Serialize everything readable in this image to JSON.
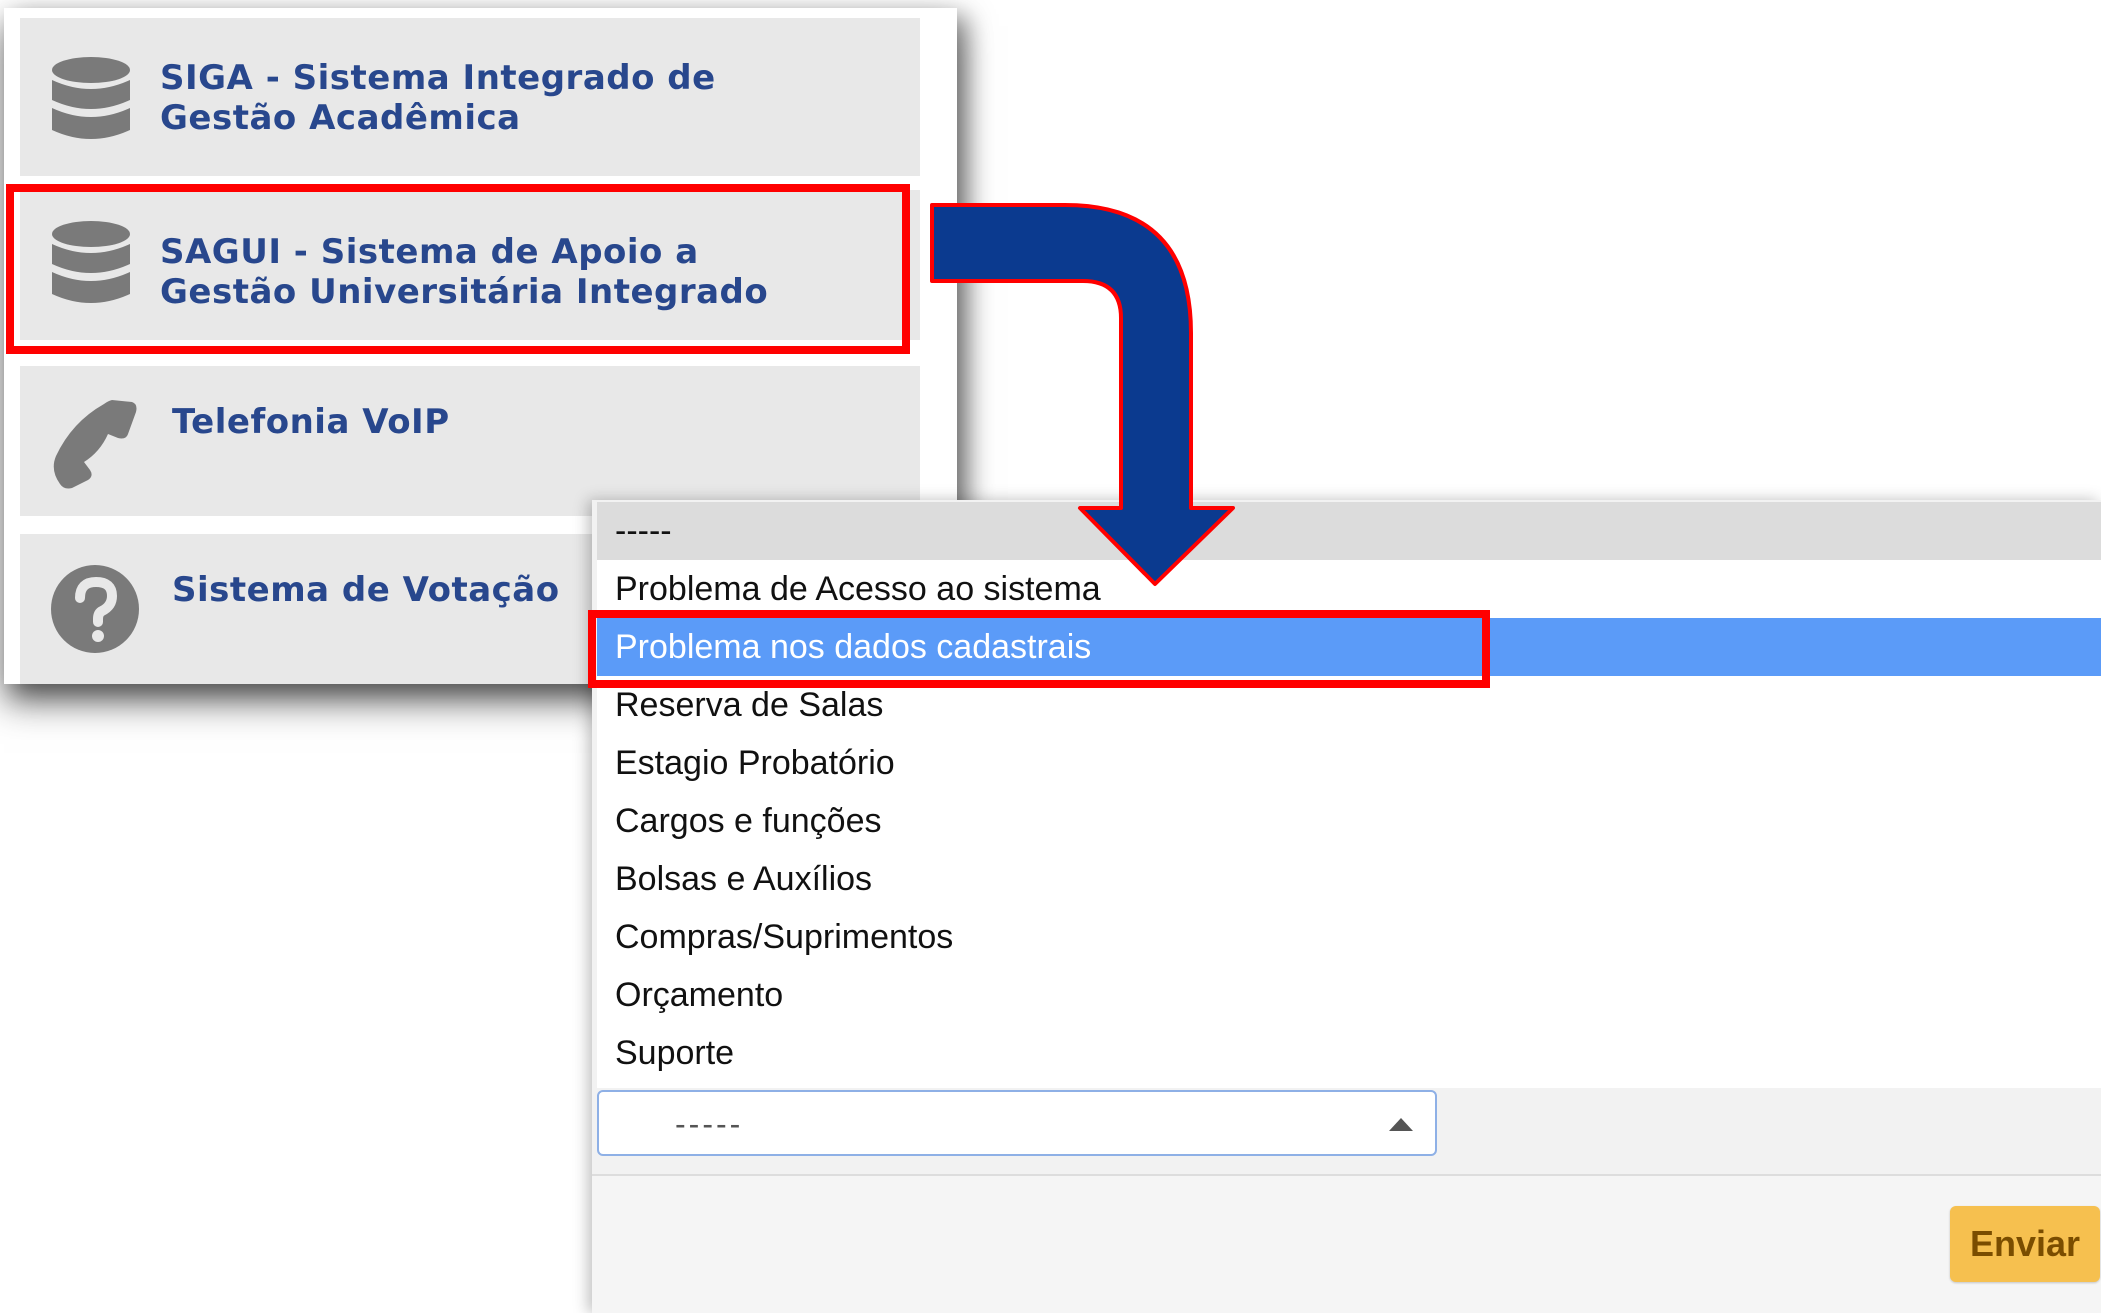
{
  "systems": [
    {
      "icon": "database-icon",
      "label": "SIGA - Sistema Integrado de\nGestão Acadêmica"
    },
    {
      "icon": "database-icon",
      "label": "SAGUI - Sistema de Apoio a\nGestão Universitária Integrado"
    },
    {
      "icon": "phone-icon",
      "label": "Telefonia VoIP"
    },
    {
      "icon": "question-icon",
      "label": "Sistema de Votação"
    }
  ],
  "dropdown": {
    "options": [
      "-----",
      "Problema de Acesso ao sistema",
      "Problema nos dados cadastrais",
      "Reserva de Salas",
      "Estagio Probatório",
      "Cargos e funções",
      "Bolsas e Auxílios",
      "Compras/Suprimentos",
      "Orçamento",
      "Suporte"
    ],
    "highlighted": "Problema nos dados cadastrais",
    "selected_value": "-----"
  },
  "form": {
    "submit_label": "Enviar"
  },
  "colors": {
    "highlight_box": "#ff0000",
    "arrow": "#0b3a8f",
    "selected_option": "#5b9bf8",
    "card_text": "#28478d",
    "submit_button": "#f6c04f"
  }
}
